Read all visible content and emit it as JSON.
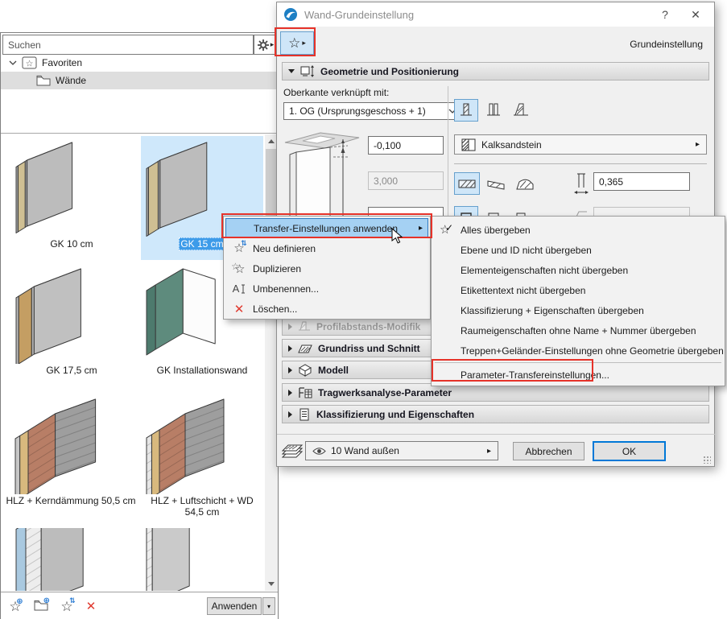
{
  "icons": {
    "submenu_arrow": "▸",
    "dropdown_arrow": "▾",
    "star": "☆",
    "check": "✓",
    "close": "✕",
    "help": "?",
    "plus_circle": "⊕",
    "sync_arrows": "⇅"
  },
  "colors": {
    "accent_blue": "#0078d7",
    "selection_fill": "#cfe6f8",
    "selection_border": "#66a0cd",
    "item_selection_bg": "#cfe8fb",
    "item_label_bg": "#3d9be9",
    "menu_highlight": "#a5d1f3",
    "menu_highlight_border": "#2f7cc4",
    "annotation_red": "#e63229",
    "delete_red": "#e03a2f"
  },
  "left_panel": {
    "search": {
      "placeholder": "Suchen"
    },
    "tree": {
      "root_label": "Favoriten",
      "child_label": "Wände"
    },
    "items": [
      {
        "label": "GK 10 cm",
        "selected": false,
        "preview": {
          "h": 82,
          "rise": 22,
          "front": {
            "c": "#bcbcbc",
            "w": 56
          },
          "layers": [
            {
              "c": "#a8a8a8",
              "w": 3
            },
            {
              "c": "#cfbf93",
              "w": 11
            },
            {
              "c": "#a8a8a8",
              "w": 3
            }
          ]
        }
      },
      {
        "label": "GK 15 cm",
        "selected": true,
        "preview": {
          "h": 84,
          "rise": 22,
          "front": {
            "c": "#bcbcbc",
            "w": 58
          },
          "layers": [
            {
              "c": "#a8a8a8",
              "w": 3
            },
            {
              "c": "#cfbf93",
              "w": 15
            },
            {
              "c": "#a8a8a8",
              "w": 3
            }
          ]
        }
      },
      {
        "label": "GK 17,5 cm",
        "selected": false,
        "preview": {
          "h": 84,
          "rise": 22,
          "front": {
            "c": "#c0c0c0",
            "w": 58
          },
          "layers": [
            {
              "c": "#b5b5b5",
              "w": 4
            },
            {
              "c": "#c49e63",
              "w": 20
            },
            {
              "c": "#b5b5b5",
              "w": 4
            }
          ]
        }
      },
      {
        "label": "GK Installationswand",
        "selected": false,
        "preview": {
          "h": 80,
          "rise": 20,
          "frame": true,
          "front": {
            "c": "#5e8b7d",
            "w": 34
          },
          "layers": [
            {
              "c": "#4d7a6d",
              "w": 14
            }
          ]
        }
      },
      {
        "label": "HLZ + Kerndämmung 50,5 cm",
        "selected": false,
        "preview": {
          "h": 78,
          "rise": 18,
          "front": {
            "c": "#9e9e9e",
            "w": 50,
            "brick": true
          },
          "layers": [
            {
              "c": "#b87e66",
              "w": 42,
              "brick": true
            },
            {
              "c": "#d8b97e",
              "w": 13
            },
            {
              "c": "#c6c6c6",
              "w": 7
            }
          ]
        }
      },
      {
        "label": "HLZ + Luftschicht + WD 54,5 cm",
        "selected": false,
        "preview": {
          "h": 78,
          "rise": 18,
          "front": {
            "c": "#9e9e9e",
            "w": 48,
            "brick": true
          },
          "layers": [
            {
              "c": "#b87e66",
              "w": 40,
              "brick": true
            },
            {
              "c": "#d8b97e",
              "w": 12
            },
            {
              "c": "#e6e6e6",
              "w": 8,
              "brick": true
            }
          ]
        }
      },
      {
        "label": "",
        "selected": false,
        "preview": {
          "h": 110,
          "rise": 20,
          "shift": 46,
          "front": {
            "c": "#bcbcbc",
            "w": 52
          },
          "layers": [
            {
              "c": "#ededed",
              "w": 24,
              "brick": true
            },
            {
              "c": "#a9c9e0",
              "w": 15
            }
          ]
        }
      },
      {
        "label": "",
        "selected": false,
        "preview": {
          "h": 110,
          "rise": 20,
          "shift": 46,
          "front": {
            "c": "#cacaca",
            "w": 46
          },
          "layers": [
            {
              "c": "#ededed",
              "w": 9,
              "brick": true
            }
          ]
        }
      }
    ],
    "footer": {
      "apply_label": "Anwenden"
    }
  },
  "dialog": {
    "title": "Wand-Grundeinstellung",
    "mode_label": "Grundeinstellung",
    "geometry_section_title": "Geometrie und Positionierung",
    "top_link_label": "Oberkante verknüpft mit:",
    "top_link_value": "1. OG (Ursprungsgeschoss + 1)",
    "top_offset_value": "-0,100",
    "height_value": "3,000",
    "material_value": "Kalksandstein",
    "thickness_value": "0,365",
    "collapsed_sections": [
      {
        "label": "Profilabstands-Modifik"
      },
      {
        "label": "Grundriss und Schnitt"
      },
      {
        "label": "Modell"
      },
      {
        "label": "Tragwerksanalyse-Parameter"
      },
      {
        "label": "Klassifizierung und Eigenschaften"
      }
    ],
    "footer": {
      "layer_value": "10 Wand außen",
      "cancel_label": "Abbrechen",
      "ok_label": "OK"
    }
  },
  "context_menu": {
    "items": [
      {
        "label": "Transfer-Einstellungen anwenden"
      },
      {
        "label": "Neu definieren"
      },
      {
        "label": "Duplizieren"
      },
      {
        "label": "Umbenennen..."
      },
      {
        "label": "Löschen..."
      }
    ]
  },
  "submenu": {
    "items": [
      {
        "label": "Alles übergeben"
      },
      {
        "label": "Ebene und ID nicht übergeben"
      },
      {
        "label": "Elementeigenschaften nicht übergeben"
      },
      {
        "label": "Etikettentext nicht übergeben"
      },
      {
        "label": "Klassifizierung + Eigenschaften übergeben"
      },
      {
        "label": "Raumeigenschaften ohne Name + Nummer übergeben"
      },
      {
        "label": "Treppen+Geländer-Einstellungen ohne Geometrie übergeben"
      },
      {
        "label": "Parameter-Transfereinstellungen..."
      }
    ]
  }
}
